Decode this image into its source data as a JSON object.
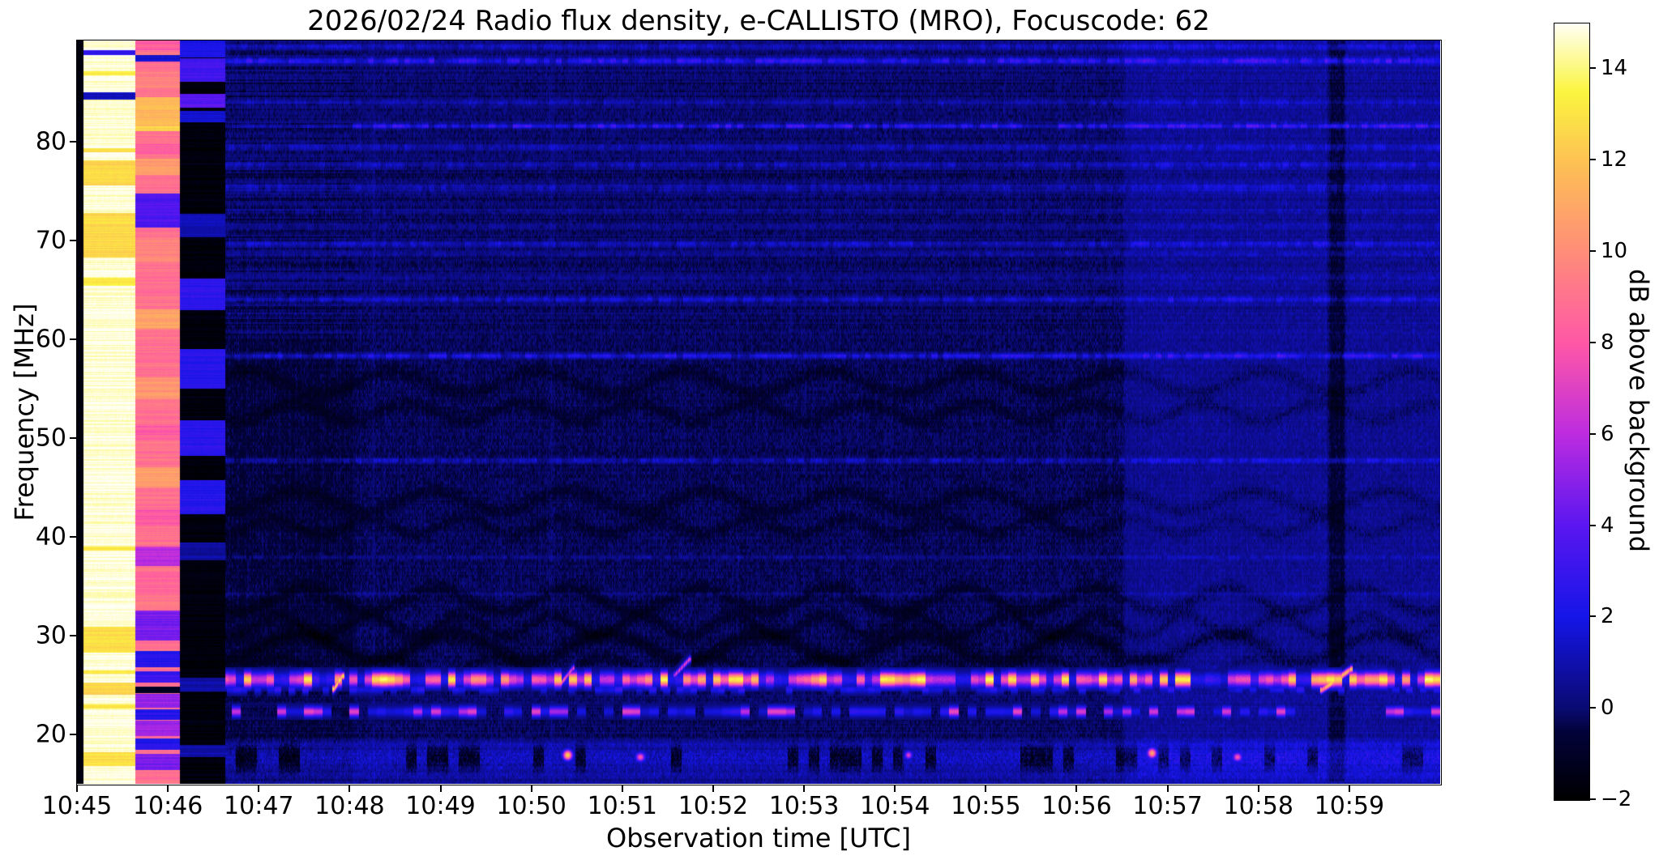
{
  "figure": {
    "title": "2026/02/24  Radio flux density, e-CALLISTO (MRO), Focuscode: 62",
    "xlabel": "Observation time [UTC]",
    "ylabel": "Frequency [MHz]",
    "colorbar_label": "dB above background"
  },
  "chart_data": {
    "type": "heatmap",
    "title": "2026/02/24  Radio flux density, e-CALLISTO (MRO), Focuscode: 62",
    "xlabel": "Observation time [UTC]",
    "ylabel": "Frequency [MHz]",
    "x_ticks": [
      "10:45",
      "10:46",
      "10:47",
      "10:48",
      "10:49",
      "10:50",
      "10:51",
      "10:52",
      "10:53",
      "10:54",
      "10:55",
      "10:56",
      "10:57",
      "10:58",
      "10:59"
    ],
    "x_tick_minutes": [
      0,
      1,
      2,
      3,
      4,
      5,
      6,
      7,
      8,
      9,
      10,
      11,
      12,
      13,
      14
    ],
    "x_range_minutes": [
      0,
      15
    ],
    "y_ticks": [
      80,
      70,
      60,
      50,
      40,
      30,
      20
    ],
    "ylim_mhz": [
      15.0,
      90.2
    ],
    "grid": false,
    "colorbar": {
      "label": "dB above background",
      "range": [
        -2,
        15
      ],
      "ticks": [
        14,
        12,
        10,
        8,
        6,
        4,
        2,
        0,
        -2
      ],
      "stops": [
        [
          -2,
          "#000000"
        ],
        [
          -0.5,
          "#02023a"
        ],
        [
          0,
          "#0a0a72"
        ],
        [
          2,
          "#1515e8"
        ],
        [
          4,
          "#5a16f0"
        ],
        [
          6,
          "#bc2ce0"
        ],
        [
          8,
          "#ff57a6"
        ],
        [
          10,
          "#ff8d78"
        ],
        [
          12,
          "#fdc253"
        ],
        [
          13.5,
          "#fbf53f"
        ],
        [
          15,
          "#fffff4"
        ]
      ]
    },
    "spectrogram": {
      "noise": {
        "base": -0.55,
        "range": 0.95
      },
      "calibration": {
        "pre_strip_end_min": 0.07,
        "columns": [
          {
            "name": "saturated-white-calibration",
            "t0": 0.07,
            "t1": 0.642,
            "base": 14.8,
            "stripe_jitter": 0.9,
            "stripes": [
              {
                "f": 91.3,
                "w": 1.6,
                "v": 13.0
              },
              {
                "f": 89.0,
                "w": 0.5,
                "v": 2.5
              },
              {
                "f": 86.9,
                "w": 0.4,
                "v": 13.2
              },
              {
                "f": 84.6,
                "w": 0.7,
                "v": 1.2
              },
              {
                "f": 79.1,
                "w": 0.4,
                "v": 13.0
              },
              {
                "f": 76.8,
                "w": 2.6,
                "v": 12.6
              },
              {
                "f": 70.5,
                "w": 4.5,
                "v": 12.8
              },
              {
                "f": 65.8,
                "w": 0.8,
                "v": 13.4
              },
              {
                "f": 38.8,
                "w": 0.4,
                "v": 13.2
              },
              {
                "f": 29.6,
                "w": 2.6,
                "v": 12.9
              },
              {
                "f": 26.3,
                "w": 0.4,
                "v": 13.1
              },
              {
                "f": 24.6,
                "w": 1.2,
                "v": 12.6
              },
              {
                "f": 22.8,
                "w": 0.4,
                "v": 13.2
              },
              {
                "f": 17.5,
                "w": 1.4,
                "v": 12.9
              }
            ]
          },
          {
            "name": "pink-orange-calibration",
            "t0": 0.642,
            "t1": 1.133,
            "base": 9.0,
            "stripe_jitter": 1.1,
            "stripes": [
              {
                "f": 90.5,
                "w": 2.6,
                "v": 8.2
              },
              {
                "f": 88.4,
                "w": 0.7,
                "v": 1.5
              },
              {
                "f": 86.3,
                "w": 1.7,
                "v": 9.6
              },
              {
                "f": 83.0,
                "w": 3.0,
                "v": 11.6
              },
              {
                "f": 81.4,
                "w": 0.8,
                "v": 12.6
              },
              {
                "f": 79.2,
                "w": 1.0,
                "v": 8.4
              },
              {
                "f": 77.4,
                "w": 1.6,
                "v": 10.6
              },
              {
                "f": 73.0,
                "w": 3.4,
                "v": 3.6
              },
              {
                "f": 69.0,
                "w": 2.4,
                "v": 9.6
              },
              {
                "f": 62.0,
                "w": 2.0,
                "v": 10.8
              },
              {
                "f": 55.0,
                "w": 2.2,
                "v": 10.4
              },
              {
                "f": 50.5,
                "w": 1.4,
                "v": 8.2
              },
              {
                "f": 46.0,
                "w": 2.0,
                "v": 10.6
              },
              {
                "f": 42.0,
                "w": 1.6,
                "v": 8.0
              },
              {
                "f": 38.0,
                "w": 2.0,
                "v": 6.0
              },
              {
                "f": 35.2,
                "w": 2.4,
                "v": 8.6
              },
              {
                "f": 31.0,
                "w": 3.0,
                "v": 4.6
              },
              {
                "f": 27.6,
                "w": 1.6,
                "v": 2.6
              },
              {
                "f": 25.8,
                "w": 1.2,
                "v": 3.2
              },
              {
                "f": 24.5,
                "w": 0.7,
                "v": -1.0
              },
              {
                "f": 23.4,
                "w": 1.4,
                "v": 5.2
              },
              {
                "f": 22.0,
                "w": 1.0,
                "v": 2.6
              },
              {
                "f": 20.6,
                "w": 1.6,
                "v": 5.4
              },
              {
                "f": 19.0,
                "w": 1.2,
                "v": 2.4
              },
              {
                "f": 17.2,
                "w": 1.6,
                "v": 4.8
              }
            ]
          },
          {
            "name": "dark-blue-calibration",
            "t0": 1.133,
            "t1": 1.632,
            "base": -1.7,
            "stripe_jitter": 0.8,
            "stripes": [
              {
                "f": 89.4,
                "w": 1.8,
                "v": 2.2
              },
              {
                "f": 87.2,
                "w": 2.4,
                "v": 3.2
              },
              {
                "f": 84.1,
                "w": 1.4,
                "v": 3.9
              },
              {
                "f": 82.5,
                "w": 1.2,
                "v": 1.6
              },
              {
                "f": 71.5,
                "w": 2.4,
                "v": 1.2
              },
              {
                "f": 64.5,
                "w": 3.2,
                "v": 2.7
              },
              {
                "f": 57.0,
                "w": 4.0,
                "v": 2.5
              },
              {
                "f": 50.0,
                "w": 3.6,
                "v": 2.6
              },
              {
                "f": 44.0,
                "w": 3.4,
                "v": 2.4
              },
              {
                "f": 38.5,
                "w": 1.8,
                "v": 0.8
              },
              {
                "f": 25.0,
                "w": 1.4,
                "v": 1.0
              },
              {
                "f": 18.3,
                "w": 1.2,
                "v": 0.9
              }
            ]
          }
        ]
      },
      "sections": {
        "main_start_min": 1.632,
        "dark_texture_until_min": 3.03,
        "bright_section_start_min": 11.5,
        "bright_boost": 0.75,
        "dark_column": {
          "t0": 13.75,
          "t1": 13.98,
          "delta": -1.15
        },
        "faint_vlines": [
          {
            "t": 3.26,
            "delta": 0.4
          },
          {
            "t": 5.22,
            "delta": 0.35
          },
          {
            "t": 8.0,
            "delta": 0.25
          }
        ]
      },
      "h_bands": [
        {
          "f": 89.6,
          "sigma": 0.25,
          "amp": 1.0
        },
        {
          "f": 88.15,
          "sigma": 0.22,
          "amp": 2.1
        },
        {
          "f": 83.9,
          "sigma": 0.28,
          "amp": 0.9
        },
        {
          "f": 81.55,
          "sigma": 0.18,
          "amp": 2.5,
          "from_min": 3.03
        },
        {
          "f": 79.4,
          "sigma": 0.25,
          "amp": 1.0
        },
        {
          "f": 77.6,
          "sigma": 0.25,
          "amp": 1.25
        },
        {
          "f": 75.3,
          "sigma": 0.3,
          "amp": 1.1
        },
        {
          "f": 72.9,
          "sigma": 0.2,
          "amp": 0.65
        },
        {
          "f": 71.4,
          "sigma": 0.2,
          "amp": 0.6
        },
        {
          "f": 69.6,
          "sigma": 0.25,
          "amp": 1.15
        },
        {
          "f": 68.6,
          "sigma": 0.18,
          "amp": 0.7
        },
        {
          "f": 66.1,
          "sigma": 0.2,
          "amp": 0.6
        },
        {
          "f": 64.0,
          "sigma": 0.25,
          "amp": 1.25
        },
        {
          "f": 58.3,
          "sigma": 0.2,
          "amp": 2.0
        },
        {
          "f": 47.7,
          "sigma": 0.18,
          "amp": 1.3
        },
        {
          "f": 37.9,
          "sigma": 0.16,
          "amp": 0.6
        },
        {
          "f": 34.2,
          "sigma": 0.16,
          "amp": 0.5
        }
      ],
      "waves": [
        {
          "f": 55.6,
          "A": 1.1,
          "wl": 1.6,
          "ph": 0.5,
          "s": 0.55,
          "sigma": 0.5
        },
        {
          "f": 52.6,
          "A": 0.9,
          "wl": 1.25,
          "ph": 2.1,
          "s": 0.5,
          "sigma": 0.45
        },
        {
          "f": 43.6,
          "A": 1.0,
          "wl": 1.5,
          "ph": 4.0,
          "s": 0.55,
          "sigma": 0.5
        },
        {
          "f": 41.0,
          "A": 0.8,
          "wl": 1.05,
          "ph": 1.2,
          "s": 0.5,
          "sigma": 0.45
        },
        {
          "f": 33.6,
          "A": 1.2,
          "wl": 1.45,
          "ph": 3.3,
          "s": 0.65,
          "sigma": 0.5
        },
        {
          "f": 31.0,
          "A": 1.0,
          "wl": 1.0,
          "ph": 0.2,
          "s": 0.6,
          "sigma": 0.45
        },
        {
          "f": 28.8,
          "A": 1.4,
          "wl": 1.7,
          "ph": 5.1,
          "s": 0.75,
          "sigma": 0.55
        },
        {
          "f": 26.9,
          "A": 0.9,
          "wl": 1.2,
          "ph": 2.6,
          "s": 0.5,
          "sigma": 0.4
        }
      ],
      "rfi_rows": [
        {
          "f": 25.55,
          "sigma": 0.5,
          "kind": "hot",
          "cell_s": 5,
          "mix": [
            [
              0.3,
              10,
              14
            ],
            [
              0.4,
              5.5,
              8.5
            ],
            [
              0.3,
              1.5,
              3.5
            ]
          ],
          "halo": 0.9
        },
        {
          "f": 24.55,
          "sigma": 0.3,
          "kind": "dash",
          "p": 0.45,
          "v0": 1.5,
          "v1": 3.2
        },
        {
          "f": 22.3,
          "sigma": 0.35,
          "kind": "mix3",
          "cell_s": 6,
          "mix": [
            [
              0.3,
              5.5,
              7.5
            ],
            [
              0.35,
              1.5,
              3.0
            ],
            [
              0.35,
              -1.6,
              -0.6
            ]
          ]
        },
        {
          "f": 19.05,
          "sigma": 0.3,
          "kind": "boost",
          "b": 0.7
        },
        {
          "f": 17.6,
          "sigma": 0.85,
          "kind": "band",
          "b": 1.5,
          "darkp": 0.28,
          "cell_s": 7
        },
        {
          "f": 15.8,
          "sigma": 0.5,
          "kind": "boost",
          "b": 0.9
        }
      ],
      "bursts": [
        {
          "kind": "diag",
          "t0": 2.83,
          "f0": 24.6,
          "t1": 2.92,
          "f1": 25.9,
          "v": 11.5,
          "wf": 0.35
        },
        {
          "kind": "diag",
          "t0": 5.33,
          "f0": 25.2,
          "t1": 5.46,
          "f1": 26.7,
          "v": 7.5,
          "wf": 0.3
        },
        {
          "kind": "diag",
          "t0": 6.58,
          "f0": 26.0,
          "t1": 6.74,
          "f1": 27.6,
          "v": 6.8,
          "wf": 0.3
        },
        {
          "kind": "diag",
          "t0": 13.7,
          "f0": 24.5,
          "t1": 14.02,
          "f1": 26.6,
          "v": 10.5,
          "wf": 0.35
        },
        {
          "kind": "spot",
          "t": 5.4,
          "f": 17.9,
          "v": 12.5,
          "wt": 0.05,
          "wf": 0.5
        },
        {
          "kind": "spot",
          "t": 6.2,
          "f": 17.7,
          "v": 8.0,
          "wt": 0.05,
          "wf": 0.45
        },
        {
          "kind": "spot",
          "t": 9.15,
          "f": 17.9,
          "v": 7.0,
          "wt": 0.04,
          "wf": 0.4
        },
        {
          "kind": "spot",
          "t": 11.83,
          "f": 18.1,
          "v": 11.0,
          "wt": 0.05,
          "wf": 0.5
        },
        {
          "kind": "spot",
          "t": 12.77,
          "f": 17.7,
          "v": 8.0,
          "wt": 0.05,
          "wf": 0.45
        }
      ]
    }
  }
}
